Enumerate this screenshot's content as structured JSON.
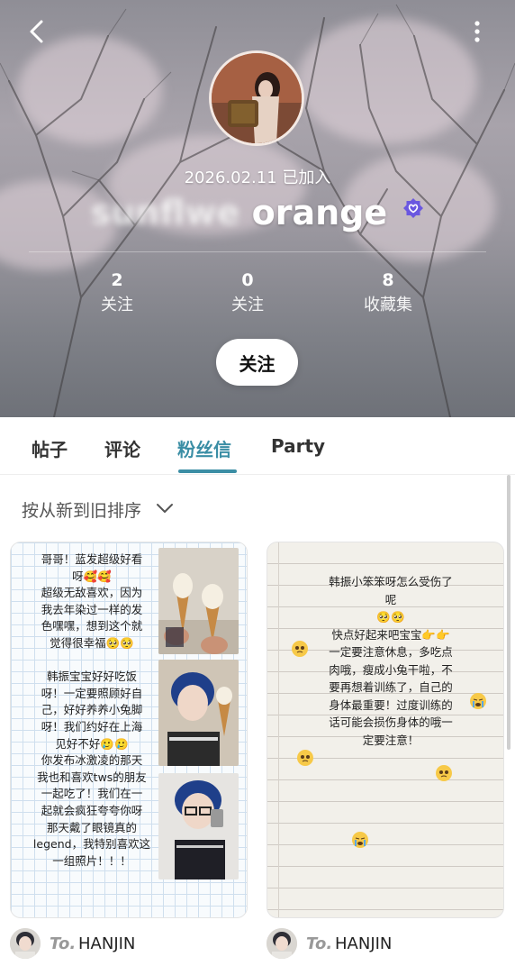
{
  "profile": {
    "joined": "2026.02.11 已加入",
    "name_hidden": "sunflwe",
    "name_visible": " orange"
  },
  "stats": [
    {
      "count": "2",
      "label": "关注"
    },
    {
      "count": "0",
      "label": "关注"
    },
    {
      "count": "8",
      "label": "收藏集"
    }
  ],
  "follow_button": "关注",
  "tabs": [
    {
      "label": "帖子",
      "active": false
    },
    {
      "label": "评论",
      "active": false
    },
    {
      "label": "粉丝信",
      "active": true
    },
    {
      "label": "Party",
      "active": false
    }
  ],
  "sort": {
    "label": "按从新到旧排序"
  },
  "cards": [
    {
      "lines": [
        "哥哥！蓝发超级好看",
        "呀🥰🥰",
        "超级无敌喜欢，因为",
        "我去年染过一样的发",
        "色嘿嘿，想到这个就",
        "觉得很幸福🥺🥺",
        "",
        "韩振宝宝好好吃饭",
        "呀！一定要照顾好自",
        "己，好好养养小兔脚",
        "呀！我们约好在上海",
        "见好不好🥲🥲",
        "你发布冰激凌的那天",
        "我也和喜欢tws的朋友",
        "一起吃了！我们在一",
        "起就会疯狂夸夸你呀",
        "那天戴了眼镜真的",
        "legend，我特别喜欢这",
        "一组照片！！！"
      ],
      "author_prefix": "To.",
      "author": "HANJIN"
    },
    {
      "lines": [
        "韩振小笨笨呀怎么受伤了",
        "呢",
        "🥺🥺",
        "快点好起来吧宝宝👉👉",
        "一定要注意休息，多吃点",
        "肉哦，瘦成小兔干啦，不",
        "要再想着训练了，自己的",
        "身体最重要！过度训练的",
        "话可能会损伤身体的哦一",
        "定要注意！"
      ],
      "author_prefix": "To.",
      "author": "HANJIN"
    }
  ],
  "colors": {
    "accent": "#3b8ea5",
    "verify_badge": "#6a57e0"
  },
  "icons": [
    "back-icon",
    "more-icon",
    "verified-icon",
    "chevron-down-icon"
  ]
}
